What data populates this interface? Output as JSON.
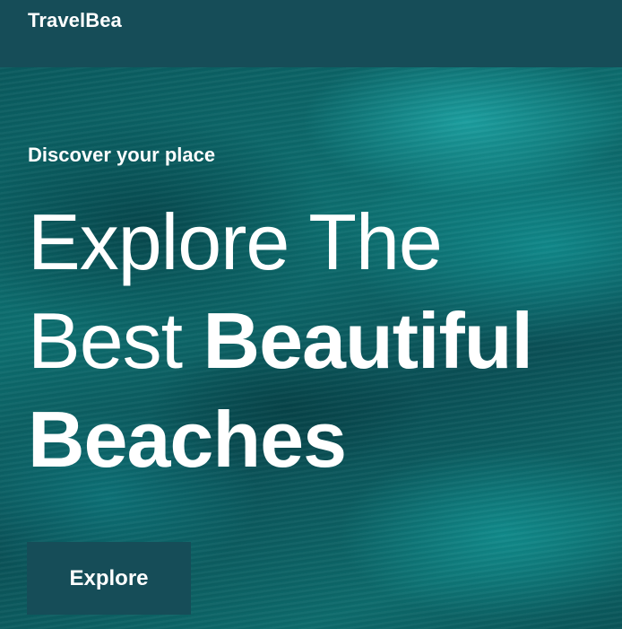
{
  "header": {
    "brand": "TravelBea"
  },
  "hero": {
    "subtitle": "Discover your place",
    "headline": {
      "line1": "Explore The",
      "line2_regular": "Best",
      "line2_bold": "Beautiful",
      "line3_bold": "Beaches"
    },
    "cta_label": "Explore",
    "background_image": "aerial-ocean-waves"
  },
  "colors": {
    "header_bg": "#164d58",
    "cta_bg": "#164d58",
    "text": "#ffffff",
    "ocean": "#0d6f70"
  }
}
